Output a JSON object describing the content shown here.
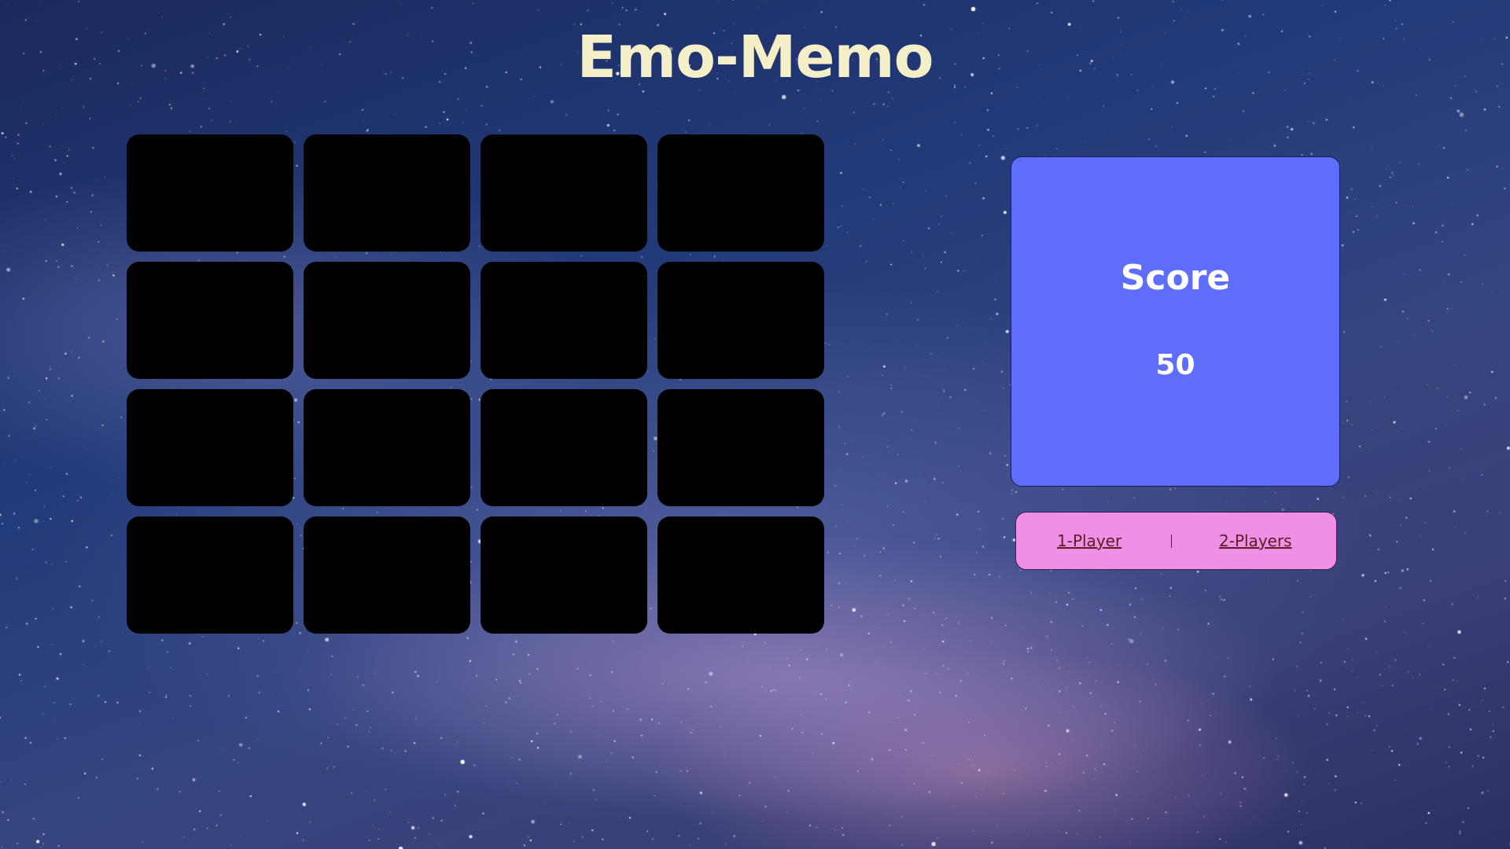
{
  "game": {
    "title": "Emo-Memo"
  },
  "board": {
    "rows": 4,
    "columns": 4,
    "card_state": "face-down"
  },
  "score_panel": {
    "label": "Score",
    "value": "50"
  },
  "mode_bar": {
    "one_player_label": "1-Player",
    "two_players_label": "2-Players"
  },
  "colors": {
    "title": "#f5efc8",
    "card_back": "#000000",
    "score_panel_bg": "#5f6dfb",
    "mode_bar_bg": "#ef90e6",
    "mode_link": "#5a1f24"
  }
}
